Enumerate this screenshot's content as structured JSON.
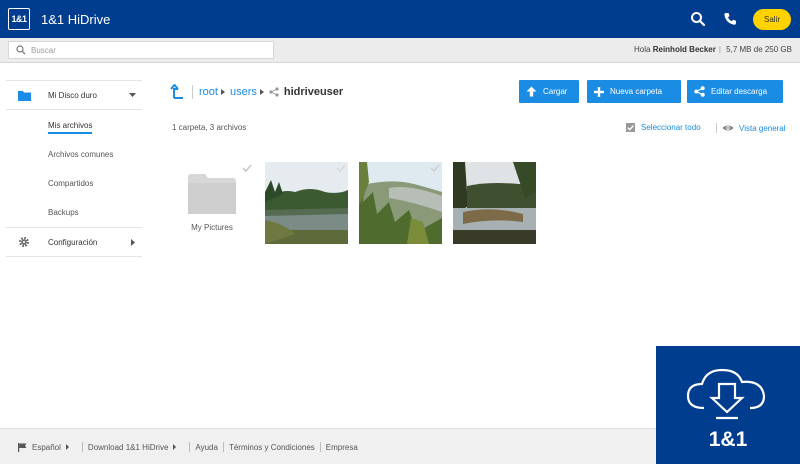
{
  "header": {
    "logo_text": "1&1",
    "app_title": "1&1 HiDrive",
    "logout_label": "Salir"
  },
  "search": {
    "placeholder": "Buscar"
  },
  "user": {
    "greeting": "Hola",
    "name": "Reinhold Becker",
    "storage": "5,7 MB de 250 GB"
  },
  "sidebar": {
    "items": [
      {
        "label": "Mi Disco duro",
        "icon": "folder-icon",
        "expandable": true
      },
      {
        "label": "Mis archivos",
        "active": true
      },
      {
        "label": "Archivos comunes"
      },
      {
        "label": "Compartidos"
      },
      {
        "label": "Backups"
      },
      {
        "label": "Configuración",
        "icon": "gear-icon",
        "expandable": true
      }
    ]
  },
  "breadcrumb": {
    "items": [
      "root",
      "users"
    ],
    "current": "hidriveuser"
  },
  "toolbar": {
    "upload_label": "Cargar",
    "new_folder_label": "Nueva carpeta",
    "edit_download_label": "Editar descarga",
    "accent_color": "#1b8ce3"
  },
  "content": {
    "summary": "1 carpeta, 3 archivos",
    "select_all_label": "Seleccionar todo",
    "view_label": "Vista general",
    "folders": [
      {
        "name": "My Pictures"
      }
    ],
    "files": [
      {
        "type": "image",
        "subject": "lake with forest"
      },
      {
        "type": "image",
        "subject": "forested hillside"
      },
      {
        "type": "image",
        "subject": "lake with trees"
      }
    ]
  },
  "footer": {
    "language": "Español",
    "links": [
      "Download 1&1 HiDrive",
      "Ayuda",
      "Términos y Condiciones",
      "Empresa"
    ]
  },
  "brand": {
    "name": "1&1",
    "color": "#003d8f"
  }
}
